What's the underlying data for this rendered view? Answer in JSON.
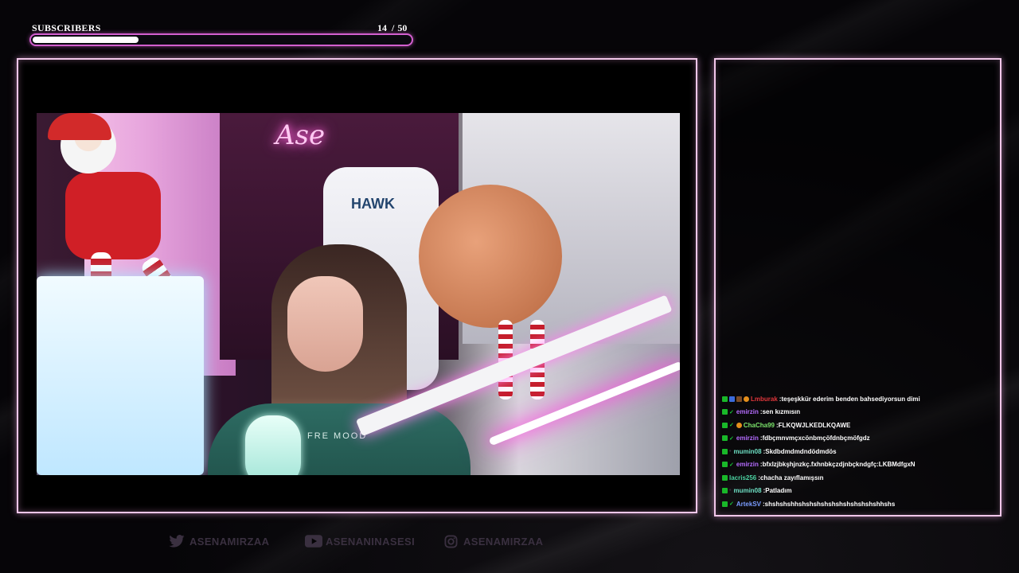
{
  "subscribers": {
    "label": "SUBSCRIBERS",
    "current": "14",
    "separator": "/",
    "goal": "50",
    "progress": 0.28,
    "accent": "#d35fcf"
  },
  "camera": {
    "neon_sign": "Ase",
    "chair_brand": "HAWK",
    "sweater_text": "FRE MOOD"
  },
  "chat": {
    "messages": [
      {
        "user": "Lmburak",
        "color": "#e0373b",
        "text": "teşeşkkür ederim benden bahsediyorsun dimi",
        "badges": [
          "mod",
          "vip",
          "sub",
          "gift"
        ]
      },
      {
        "user": "emirzin",
        "color": "#b56cff",
        "text": "sen kızmısın",
        "badges": [
          "mod",
          "check"
        ]
      },
      {
        "user": "ChaCha99",
        "color": "#7be36b",
        "text": "FLKQWJLKEDLKQAWE",
        "badges": [
          "mod",
          "check",
          "gift"
        ]
      },
      {
        "user": "emirzin",
        "color": "#b56cff",
        "text": "fdbçmnvmçxcönbmçöfdnbçmöfgdz",
        "badges": [
          "mod",
          "check"
        ]
      },
      {
        "user": "mumin08",
        "color": "#6ee0c4",
        "text": "Skdbdmdmdndödmdös",
        "badges": [
          "mod",
          "dot"
        ]
      },
      {
        "user": "emirzin",
        "color": "#b56cff",
        "text": "bfxlzjbkşhjnzkç.fxhnbkçzdjnbçkndgfç:LKBMdfgxN",
        "badges": [
          "mod",
          "check"
        ]
      },
      {
        "user": "lacris256",
        "color": "#4ad1a0",
        "text": "chacha zayıflamışsın",
        "badges": [
          "mod"
        ]
      },
      {
        "user": "mumin08",
        "color": "#6ee0c4",
        "text": "Patladım",
        "badges": [
          "mod",
          "dot"
        ]
      },
      {
        "user": "ArtekSV",
        "color": "#7a9cff",
        "text": "shshshshhshshshshshshshshshshshhshs",
        "badges": [
          "mod",
          "check"
        ]
      }
    ]
  },
  "socials": [
    {
      "icon": "twitter-icon",
      "label": "ASENAMIRZAA"
    },
    {
      "icon": "youtube-icon",
      "label": "ASENANINASESI"
    },
    {
      "icon": "instagram-icon",
      "label": "ASENAMIRZAA"
    }
  ]
}
